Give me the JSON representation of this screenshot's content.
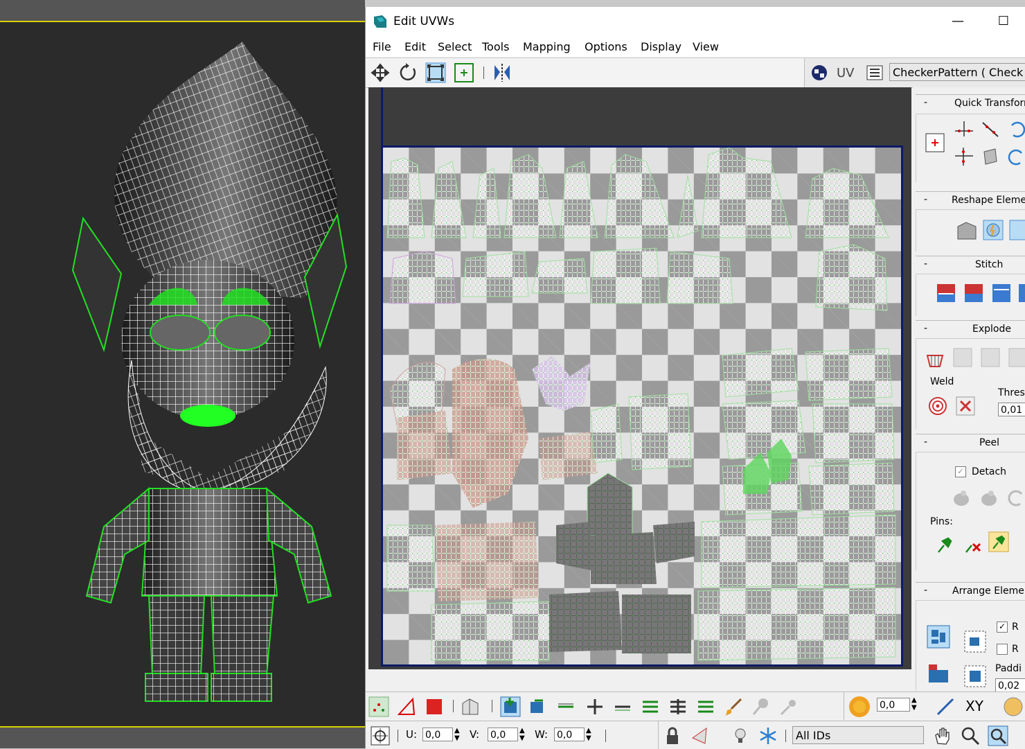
{
  "window": {
    "title": "Edit UVWs",
    "minimize_glyph": "—",
    "maximize_glyph": "☐"
  },
  "menu": [
    "File",
    "Edit",
    "Select",
    "Tools",
    "Mapping",
    "Options",
    "Display",
    "View"
  ],
  "toolbar": {
    "uv_label": "UV",
    "texture_dropdown": "CheckerPattern  ( Check"
  },
  "panel": {
    "quick_transform": "Quick Transform",
    "reshape_elements": "Reshape Elemen",
    "stitch": "Stitch",
    "explode": "Explode",
    "weld": "Weld",
    "threshold_label": "Thres",
    "threshold_value": "0,01",
    "peel": "Peel",
    "detach_label": "Detach",
    "pins_label": "Pins:",
    "arrange_elements": "Arrange Elemen",
    "arrange_opt1": "R",
    "arrange_opt2": "R",
    "padding_label": "Paddi",
    "padding_value": "0,02"
  },
  "bottom": {
    "soft_value": "0,0",
    "xy_label": "XY",
    "u_label": "U:",
    "u_value": "0,0",
    "v_label": "V:",
    "v_value": "0,0",
    "w_label": "W:",
    "w_value": "0,0",
    "id_filter": "All IDs"
  },
  "colors": {
    "uv_border": "#0d1a66",
    "viewport_bg": "#2b2b2b",
    "wire_white": "#ffffff",
    "wire_green": "#22e022",
    "viewport_active": "#d8d000"
  },
  "icons": [
    "move-icon",
    "rotate-icon",
    "scale-icon",
    "freeform-icon",
    "mirror-icon",
    "checker-map-icon",
    "list-icon",
    "pivot-icon",
    "weld-target-icon",
    "pin-icon",
    "lock-icon",
    "hand-pan-icon",
    "zoom-icon"
  ]
}
